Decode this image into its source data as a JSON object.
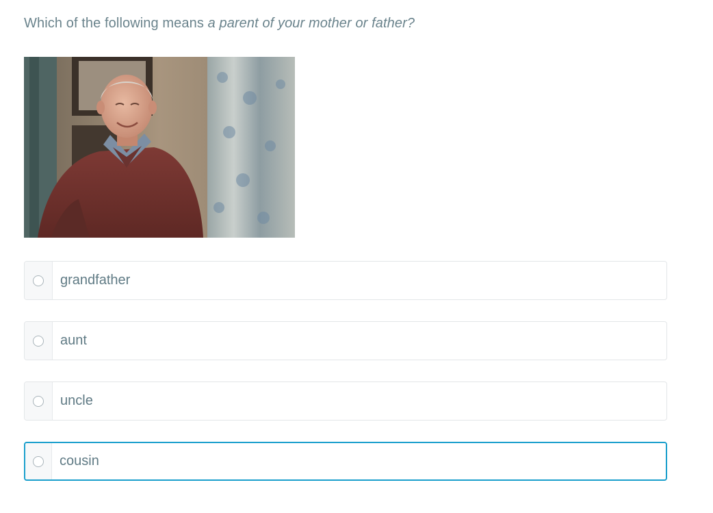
{
  "question": {
    "prefix": "Which of the following means ",
    "emphasis": "a parent of your mother or father?"
  },
  "image": {
    "subject": "smiling elderly man in maroon sweater"
  },
  "options": [
    {
      "label": "grandfather",
      "selected": false
    },
    {
      "label": "aunt",
      "selected": false
    },
    {
      "label": "uncle",
      "selected": false
    },
    {
      "label": "cousin",
      "selected": true
    }
  ],
  "colors": {
    "text": "#6a838c",
    "border": "#e3e6e8",
    "selected_border": "#1a9fcc",
    "radio_cell_bg": "#f7f8f9"
  }
}
